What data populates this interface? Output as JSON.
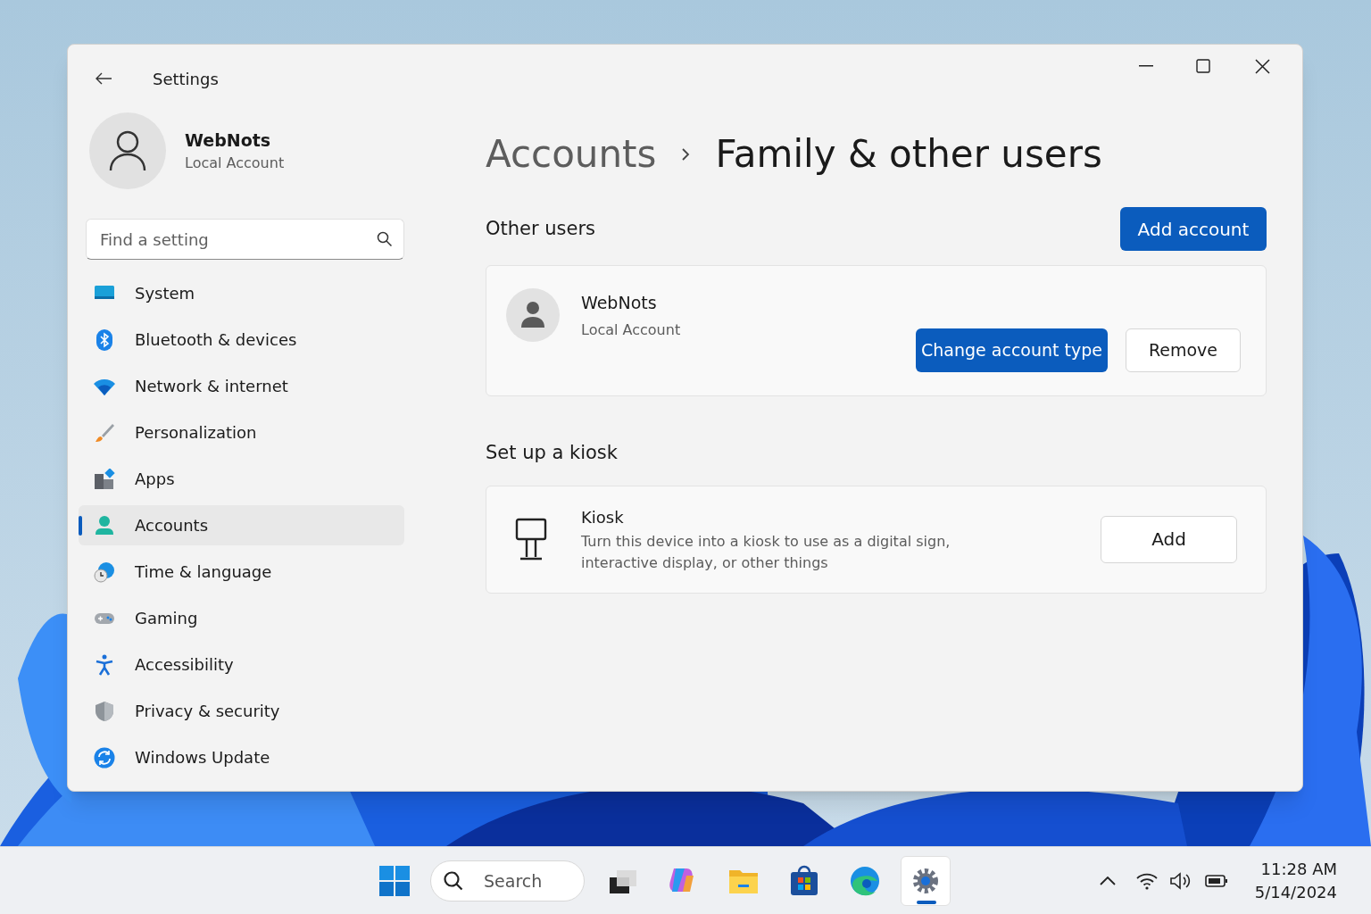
{
  "window": {
    "title": "Settings"
  },
  "profile": {
    "name": "WebNots",
    "subtitle": "Local Account"
  },
  "search": {
    "placeholder": "Find a setting"
  },
  "sidebar": {
    "items": [
      {
        "label": "System",
        "selected": false
      },
      {
        "label": "Bluetooth & devices",
        "selected": false
      },
      {
        "label": "Network & internet",
        "selected": false
      },
      {
        "label": "Personalization",
        "selected": false
      },
      {
        "label": "Apps",
        "selected": false
      },
      {
        "label": "Accounts",
        "selected": true
      },
      {
        "label": "Time & language",
        "selected": false
      },
      {
        "label": "Gaming",
        "selected": false
      },
      {
        "label": "Accessibility",
        "selected": false
      },
      {
        "label": "Privacy & security",
        "selected": false
      },
      {
        "label": "Windows Update",
        "selected": false
      }
    ]
  },
  "breadcrumb": {
    "parent": "Accounts",
    "current": "Family & other users"
  },
  "other_users": {
    "heading": "Other users",
    "add_button": "Add account",
    "users": [
      {
        "name": "WebNots",
        "subtitle": "Local Account",
        "primary_button": "Change account type",
        "secondary_button": "Remove"
      }
    ]
  },
  "kiosk": {
    "heading": "Set up a kiosk",
    "title": "Kiosk",
    "description": "Turn this device into a kiosk to use as a digital sign, interactive display, or other things",
    "button": "Add"
  },
  "taskbar": {
    "search_placeholder": "Search",
    "apps": [
      {
        "selected": false
      },
      {
        "selected": false
      },
      {
        "selected": false
      },
      {
        "selected": false
      },
      {
        "selected": false
      },
      {
        "selected": true
      }
    ],
    "clock": {
      "time": "11:28 AM",
      "date": "5/14/2024"
    }
  }
}
